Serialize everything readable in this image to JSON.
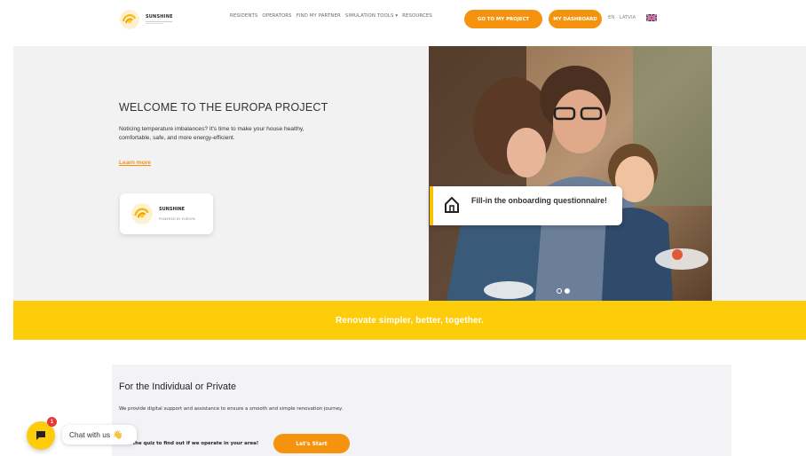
{
  "header": {
    "logo_title": "SUNSHINE",
    "nav": [
      "RESIDENTS",
      "OPERATORS",
      "FIND MY PARTNER",
      "SIMULATION TOOLS ▾",
      "RESOURCES"
    ],
    "btn_project": "GO TO MY PROJECT",
    "btn_dashboard": "MY DASHBOARD",
    "lang": "EN · LATVIA"
  },
  "hero": {
    "title": "WELCOME TO THE EUROPA PROJECT",
    "text": "Noticing temperature imbalances? It's time to make your house healthy, comfortable, safe, and more energy-efficient.",
    "link": "Learn more",
    "badge_title": "SUNSHINE",
    "badge_sub": "POWERED BY EUROPA"
  },
  "slide": {
    "caption": "Fill-in the onboarding questionnaire!"
  },
  "band": {
    "text": "Renovate simpler, better, together."
  },
  "card": {
    "title": "For the Individual or Private",
    "text": "We provide digital support and assistance to ensure a smooth and simple renovation journey.",
    "quiz": "Take the quiz to find out if we operate in your area!",
    "button": "Let's Start"
  },
  "chat": {
    "badge": "1",
    "label": "Chat with us",
    "wave": "👋"
  },
  "colors": {
    "accent": "#f5930f",
    "band": "#fdcc0a"
  }
}
